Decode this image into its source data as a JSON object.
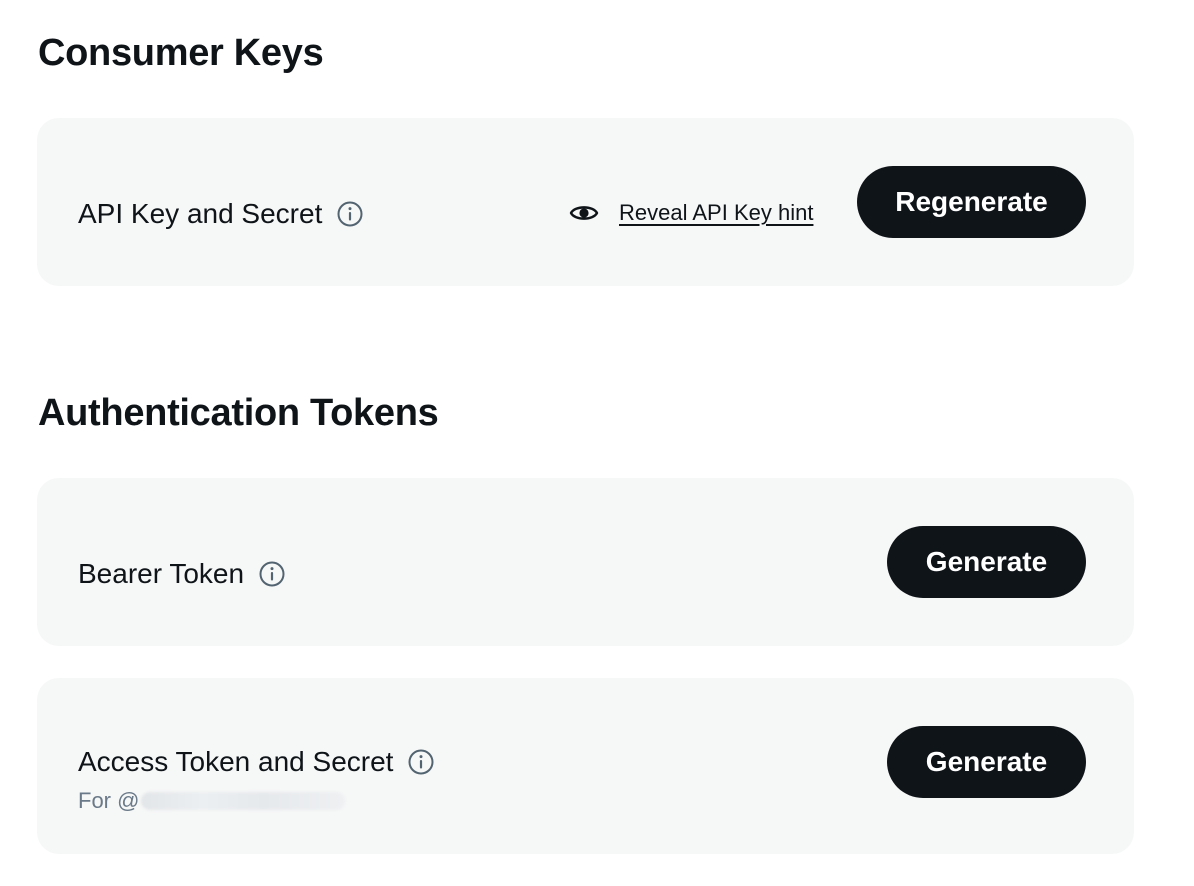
{
  "consumer_keys": {
    "title": "Consumer Keys",
    "api_key_label": "API Key and Secret",
    "reveal_link": "Reveal API Key hint",
    "regenerate_label": "Regenerate"
  },
  "auth_tokens": {
    "title": "Authentication Tokens",
    "bearer": {
      "label": "Bearer Token",
      "button_label": "Generate"
    },
    "access": {
      "label": "Access Token and Secret",
      "sublabel_prefix": "For @",
      "button_label": "Generate"
    }
  },
  "icons": {
    "info": "info-icon",
    "reveal": "eye-icon"
  },
  "colors": {
    "button_bg": "#0f1419",
    "card_bg": "#f6f7f7",
    "muted_text": "#6b7a89"
  }
}
